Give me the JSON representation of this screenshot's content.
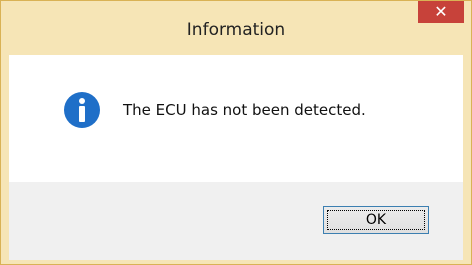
{
  "window": {
    "title": "Information"
  },
  "close_button": {
    "label": "✕",
    "icon": "close-icon"
  },
  "message": {
    "icon": "info-icon",
    "text": "The ECU has not been detected."
  },
  "ok_button": {
    "label": "OK"
  },
  "colors": {
    "frame": "#f6e5b6",
    "close_bg": "#c7423a",
    "icon_blue": "#1f6fc8",
    "footer_bg": "#f0f0f0"
  }
}
